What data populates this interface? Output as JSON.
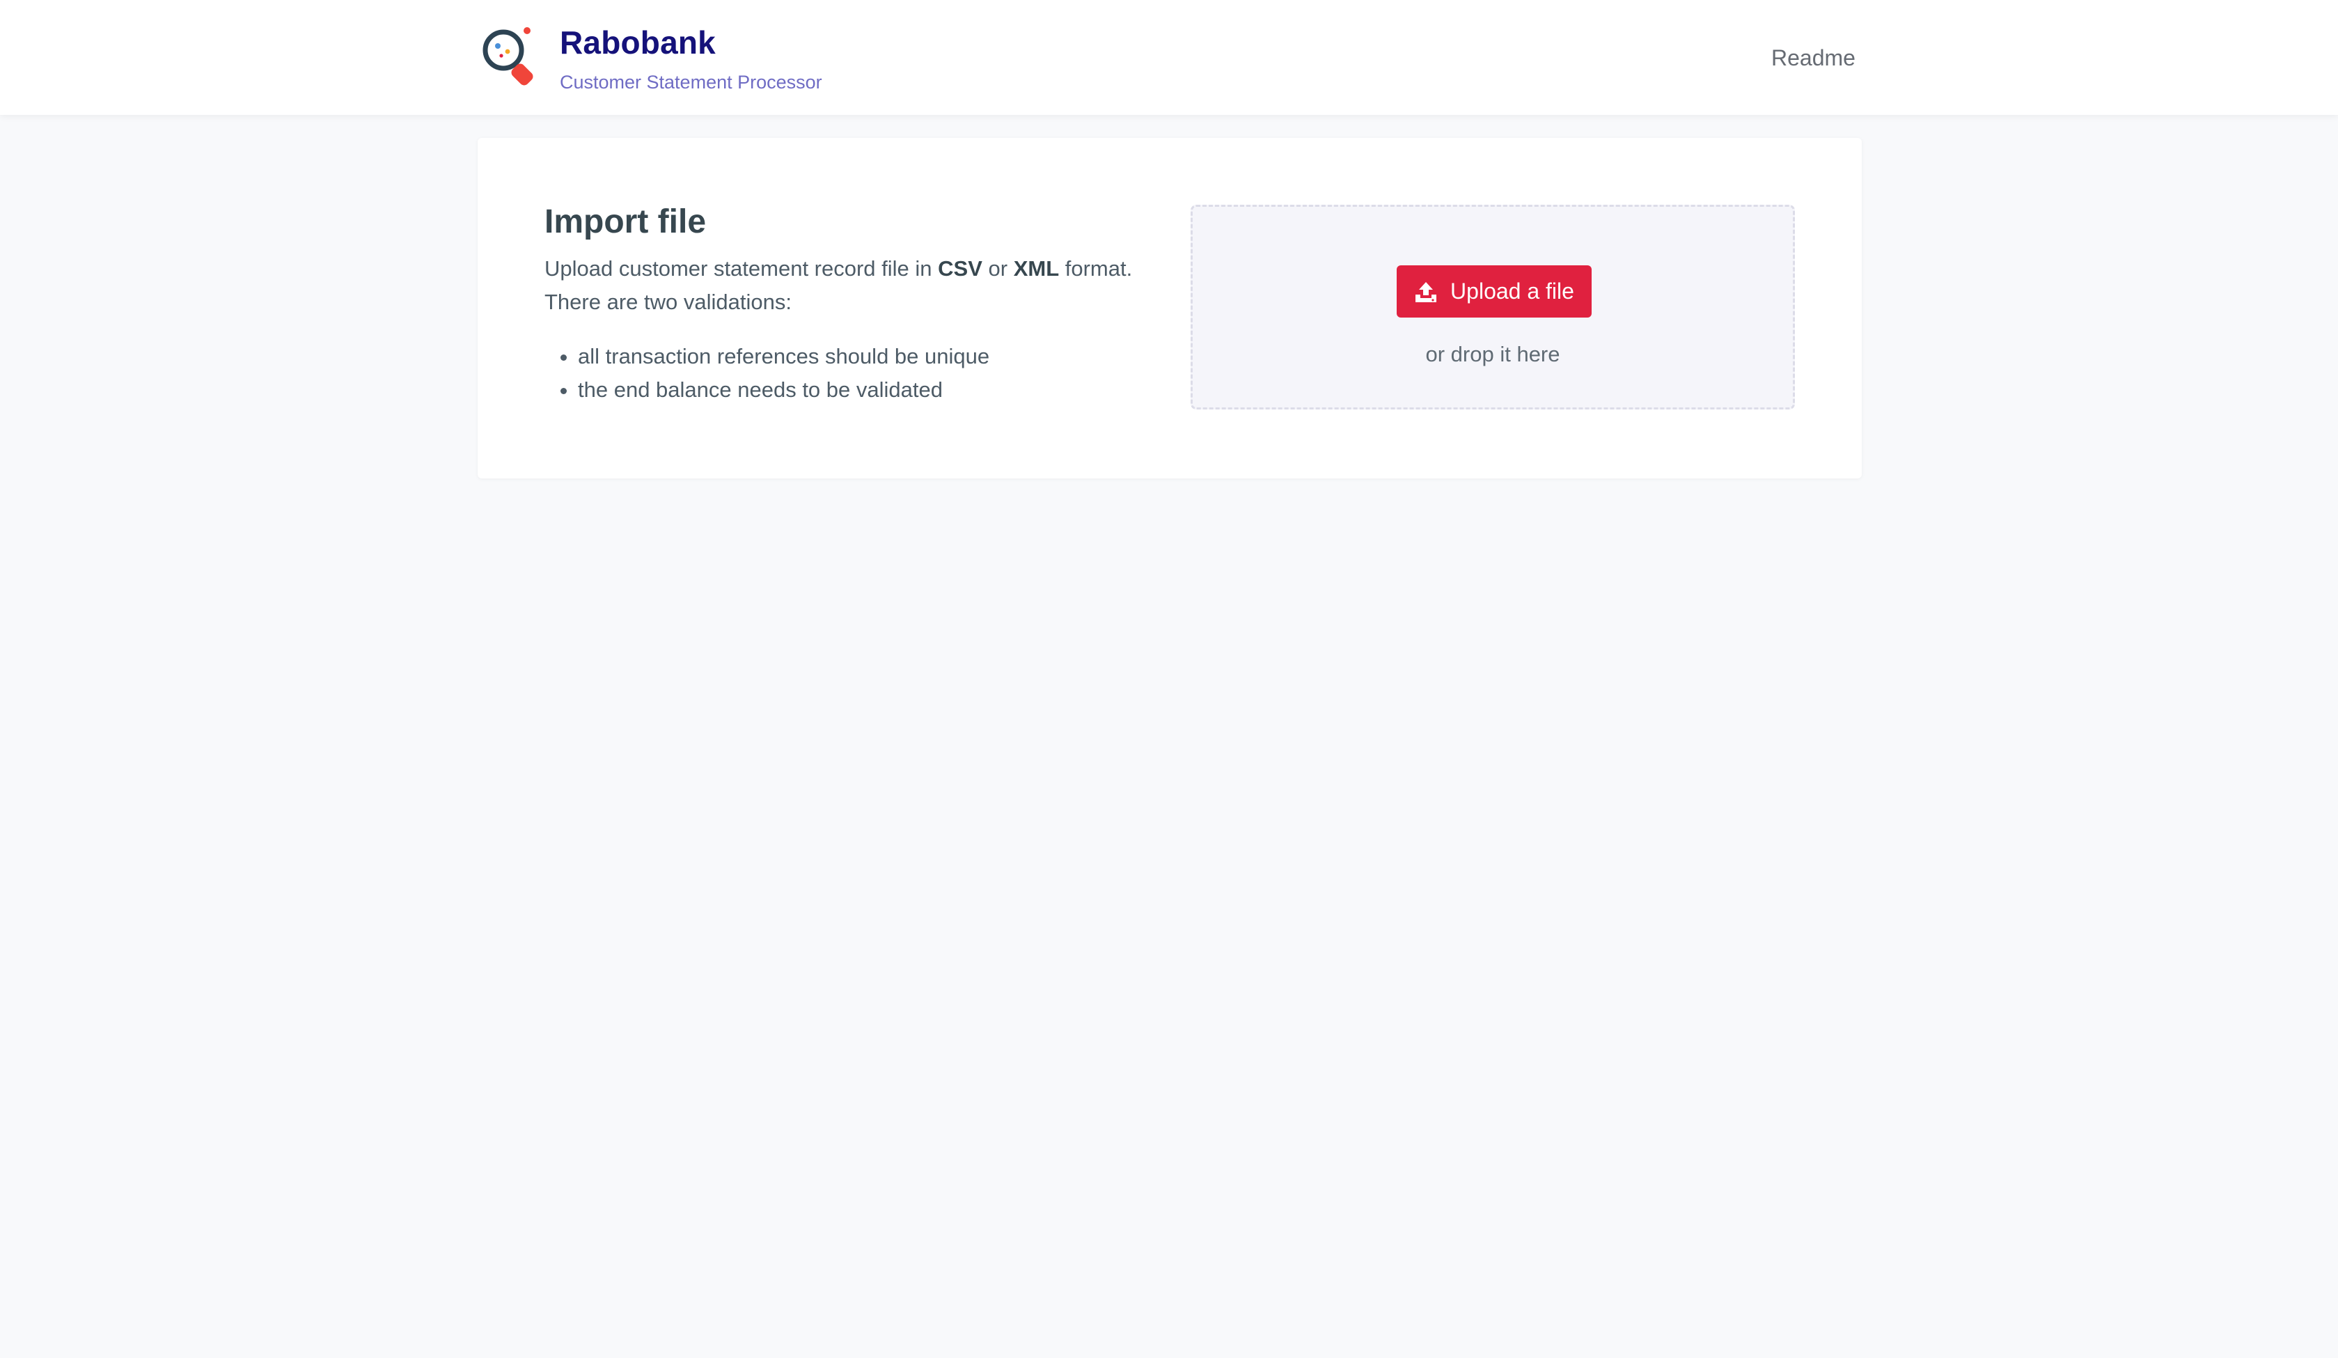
{
  "header": {
    "brand_title": "Rabobank",
    "brand_subtitle": "Customer Statement Processor",
    "logo_icon": "magnifier-logo-icon",
    "nav": {
      "readme_label": "Readme"
    }
  },
  "import_card": {
    "title": "Import file",
    "description_prefix": "Upload customer statement record file in ",
    "format_csv": "CSV",
    "description_or": " or ",
    "format_xml": "XML",
    "description_suffix": " format. There are two validations:",
    "validations": [
      "all transaction references should be unique",
      "the end balance needs to be validated"
    ]
  },
  "dropzone": {
    "button_label": "Upload a file",
    "button_icon": "upload-icon",
    "hint": "or drop it here"
  },
  "colors": {
    "brand_navy": "#15127a",
    "brand_subtitle": "#6f6cc4",
    "accent_red": "#e0213f",
    "page_background": "#f8f9fb"
  }
}
